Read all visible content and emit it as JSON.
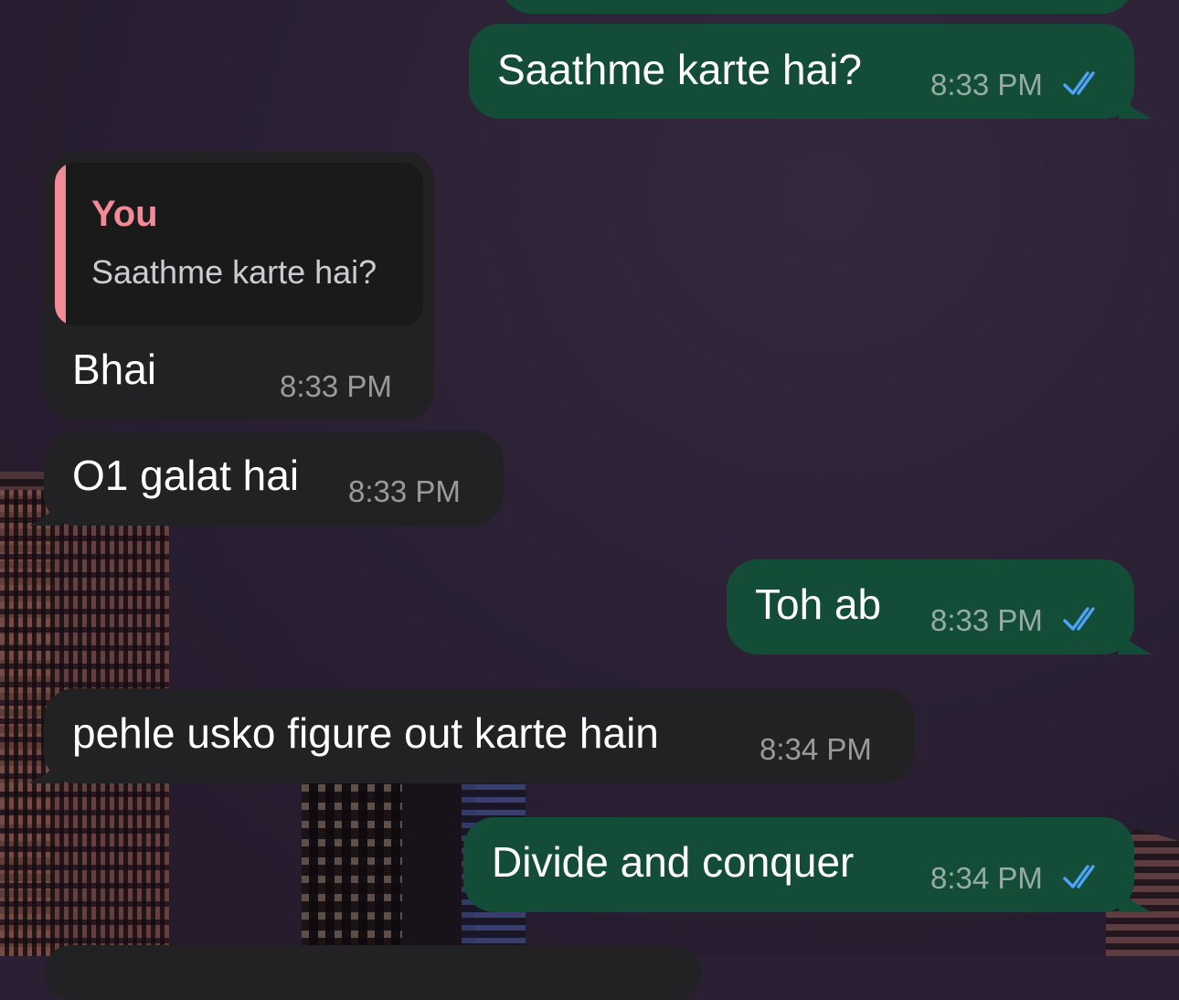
{
  "messages": [
    {
      "direction": "outgoing",
      "text": "Saathme karte hai?",
      "time": "8:33 PM",
      "status": "read"
    },
    {
      "direction": "incoming",
      "reply_to": {
        "author": "You",
        "text": "Saathme karte hai?"
      },
      "text": "Bhai",
      "time": "8:33 PM"
    },
    {
      "direction": "incoming",
      "text": "O1 galat hai",
      "time": "8:33 PM"
    },
    {
      "direction": "outgoing",
      "text": "Toh ab",
      "time": "8:33 PM",
      "status": "read"
    },
    {
      "direction": "incoming",
      "text": "pehle usko figure out karte hain",
      "time": "8:34 PM"
    },
    {
      "direction": "outgoing",
      "text": "Divide and conquer",
      "time": "8:34 PM",
      "status": "read"
    }
  ],
  "colors": {
    "outgoing_bubble": "#134d37",
    "incoming_bubble": "#222224",
    "quote_accent": "#f28b96",
    "read_ticks": "#4fa3f7"
  },
  "icons": {
    "read_receipt": "double-check-icon"
  }
}
